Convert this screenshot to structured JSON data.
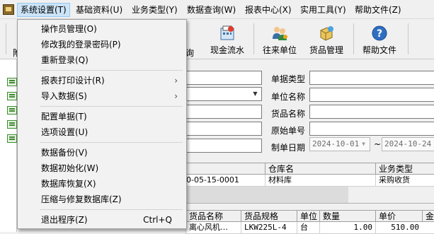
{
  "menubar": {
    "items": [
      "系统设置(T)",
      "基础资料(U)",
      "业务类型(Y)",
      "数据查询(W)",
      "报表中心(X)",
      "实用工具(Y)",
      "帮助文件(Z)"
    ]
  },
  "toolbar": {
    "partial_left": "附",
    "partial_query": "询",
    "buttons": [
      {
        "label": "现金流水",
        "icon": "cash-flow-icon"
      },
      {
        "label": "往来单位",
        "icon": "contacts-icon"
      },
      {
        "label": "货品管理",
        "icon": "goods-icon"
      },
      {
        "label": "帮助文件",
        "icon": "help-icon"
      }
    ]
  },
  "dropdown": {
    "items": [
      {
        "label": "操作员管理(O)"
      },
      {
        "label": "修改我的登录密码(P)"
      },
      {
        "label": "重新登录(Q)"
      },
      {
        "label": "报表打印设计(R)",
        "submenu": "›"
      },
      {
        "label": "导入数据(S)",
        "submenu": "›"
      },
      {
        "label": "配置单据(T)"
      },
      {
        "label": "选项设置(U)"
      },
      {
        "label": "数据备份(V)"
      },
      {
        "label": "数据初始化(W)"
      },
      {
        "label": "数据库恢复(X)"
      },
      {
        "label": "压缩与修复数据库(Z)"
      },
      {
        "label": "退出程序(Z)",
        "shortcut": "Ctrl+Q"
      }
    ]
  },
  "form": {
    "labels": {
      "doc_type": "单据类型",
      "unit_name": "单位名称",
      "goods_name": "货品名称",
      "original_no": "原始单号",
      "doc_date": "制单日期"
    },
    "date_from": "2024-10-01",
    "date_to": "2024-10-24",
    "date_sep": "~"
  },
  "grid1": {
    "headers": [
      "仓库名",
      "业务类型"
    ],
    "row": {
      "doc_no": "0-05-15-0001",
      "warehouse": "材料库",
      "biz_type": "采购收货"
    }
  },
  "grid2": {
    "headers": [
      "货品名称",
      "货品规格",
      "单位",
      "数量",
      "单价",
      "金"
    ],
    "row": {
      "prefix": "…",
      "name": "离心风机",
      "ellipsis": "…",
      "spec": "LKW225L-4",
      "unit": "台",
      "qty": "1.00",
      "price": "510.00"
    }
  },
  "colors": {
    "menu_active": "#cce4f7",
    "menu_bg": "#f2f2f2"
  }
}
